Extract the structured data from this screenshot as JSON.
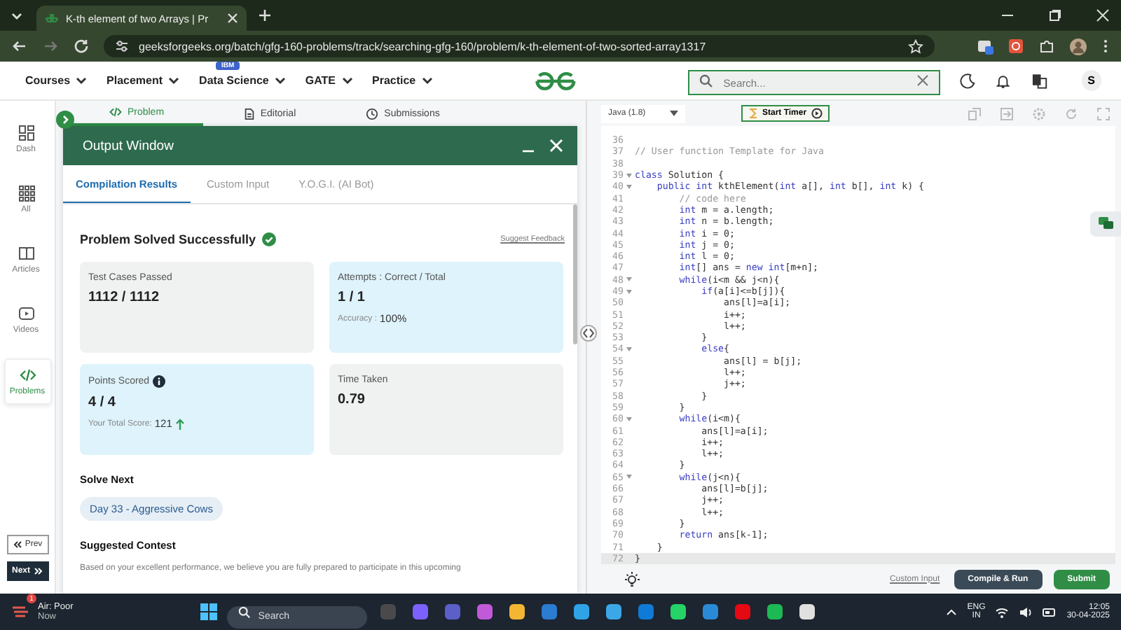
{
  "browser": {
    "tab_title": "K-th element of two Arrays | Pr",
    "url": "geeksforgeeks.org/batch/gfg-160-problems/track/searching-gfg-160/problem/k-th-element-of-two-sorted-array1317"
  },
  "site_nav": {
    "items": [
      {
        "label": "Courses"
      },
      {
        "label": "Placement"
      },
      {
        "label": "Data Science",
        "badge": "IBM"
      },
      {
        "label": "GATE"
      },
      {
        "label": "Practice"
      }
    ],
    "search": {
      "placeholder": "Search..."
    },
    "avatar": "S"
  },
  "sidebar": {
    "items": [
      {
        "label": "Dash",
        "kind": "dash",
        "selected": false
      },
      {
        "label": "All",
        "kind": "all",
        "selected": false
      },
      {
        "label": "Articles",
        "kind": "articles",
        "selected": false
      },
      {
        "label": "Videos",
        "kind": "videos",
        "selected": false
      },
      {
        "label": "Problems",
        "kind": "problems",
        "selected": true
      }
    ],
    "prev": "Prev",
    "next": "Next"
  },
  "problem_tabs": [
    {
      "label": "Problem",
      "kind": "code",
      "selected": true
    },
    {
      "label": "Editorial",
      "kind": "doc",
      "selected": false
    },
    {
      "label": "Submissions",
      "kind": "clock",
      "selected": false
    }
  ],
  "output_window": {
    "title": "Output Window",
    "tabs": [
      {
        "label": "Compilation Results",
        "selected": true
      },
      {
        "label": "Custom Input",
        "selected": false
      },
      {
        "label": "Y.O.G.I. (AI Bot)",
        "selected": false
      }
    ],
    "status": "Problem Solved Successfully",
    "feedback_link": "Suggest Feedback",
    "cards": [
      {
        "label": "Test Cases Passed",
        "value": "1112 / 1112",
        "tinted": false,
        "info": false,
        "rising": false
      },
      {
        "label": "Attempts : Correct / Total",
        "value": "1 / 1",
        "tinted": true,
        "info": false,
        "rising": false,
        "note": {
          "label": "Accuracy : ",
          "value": "100%"
        }
      },
      {
        "label": "Points Scored",
        "value": "4 / 4",
        "tinted": true,
        "info": true,
        "rising": true,
        "note": {
          "label": "Your Total Score: ",
          "value": "121"
        }
      },
      {
        "label": "Time Taken",
        "value": "0.79",
        "tinted": false,
        "info": false,
        "rising": false
      }
    ],
    "solve_next": {
      "heading": "Solve Next",
      "chip": "Day 33 - Aggressive Cows"
    },
    "suggested_contest": {
      "heading": "Suggested Contest",
      "text": "Based on your excellent performance, we believe you are fully prepared to participate in this upcoming"
    }
  },
  "editor": {
    "language": "Java (1.8)",
    "timer_button": "Start Timer",
    "lines": [
      {
        "number": "36",
        "fold": false,
        "current": false
      },
      {
        "number": "37",
        "fold": false,
        "current": false,
        "parts": [
          {
            "kind": "comment",
            "text": "// User function Template for Java"
          }
        ]
      },
      {
        "number": "38",
        "fold": false,
        "current": false
      },
      {
        "number": "39",
        "fold": true,
        "current": false,
        "parts": [
          {
            "kind": "keyword",
            "text": "class"
          },
          {
            "kind": "plain",
            "text": " Solution {"
          }
        ]
      },
      {
        "number": "40",
        "fold": true,
        "current": false,
        "parts": [
          {
            "kind": "keyword",
            "text": "    public int"
          },
          {
            "kind": "plain",
            "text": " kthElement("
          },
          {
            "kind": "keyword",
            "text": "int"
          },
          {
            "kind": "plain",
            "text": " a[], "
          },
          {
            "kind": "keyword",
            "text": "int"
          },
          {
            "kind": "plain",
            "text": " b[], "
          },
          {
            "kind": "keyword",
            "text": "int"
          },
          {
            "kind": "plain",
            "text": " k) {"
          }
        ]
      },
      {
        "number": "41",
        "fold": false,
        "current": false,
        "parts": [
          {
            "kind": "comment",
            "text": "        // code here"
          }
        ]
      },
      {
        "number": "42",
        "fold": false,
        "current": false,
        "parts": [
          {
            "kind": "keyword",
            "text": "        int"
          },
          {
            "kind": "plain",
            "text": " m = a.length;"
          }
        ]
      },
      {
        "number": "43",
        "fold": false,
        "current": false,
        "parts": [
          {
            "kind": "keyword",
            "text": "        int"
          },
          {
            "kind": "plain",
            "text": " n = b.length;"
          }
        ]
      },
      {
        "number": "44",
        "fold": false,
        "current": false,
        "parts": [
          {
            "kind": "keyword",
            "text": "        int"
          },
          {
            "kind": "plain",
            "text": " i = 0;"
          }
        ]
      },
      {
        "number": "45",
        "fold": false,
        "current": false,
        "parts": [
          {
            "kind": "keyword",
            "text": "        int"
          },
          {
            "kind": "plain",
            "text": " j = 0;"
          }
        ]
      },
      {
        "number": "46",
        "fold": false,
        "current": false,
        "parts": [
          {
            "kind": "keyword",
            "text": "        int"
          },
          {
            "kind": "plain",
            "text": " l = 0;"
          }
        ]
      },
      {
        "number": "47",
        "fold": false,
        "current": false,
        "parts": [
          {
            "kind": "keyword",
            "text": "        int"
          },
          {
            "kind": "plain",
            "text": "[] ans = "
          },
          {
            "kind": "keyword",
            "text": "new int"
          },
          {
            "kind": "plain",
            "text": "[m+n];"
          }
        ]
      },
      {
        "number": "48",
        "fold": true,
        "current": false,
        "parts": [
          {
            "kind": "keyword",
            "text": "        while"
          },
          {
            "kind": "plain",
            "text": "(i<m && j<n){"
          }
        ]
      },
      {
        "number": "49",
        "fold": true,
        "current": false,
        "parts": [
          {
            "kind": "keyword",
            "text": "            if"
          },
          {
            "kind": "plain",
            "text": "(a[i]<=b[j]){"
          }
        ]
      },
      {
        "number": "50",
        "fold": false,
        "current": false,
        "parts": [
          {
            "kind": "plain",
            "text": "                ans[l]=a[i];"
          }
        ]
      },
      {
        "number": "51",
        "fold": false,
        "current": false,
        "parts": [
          {
            "kind": "plain",
            "text": "                i++;"
          }
        ]
      },
      {
        "number": "52",
        "fold": false,
        "current": false,
        "parts": [
          {
            "kind": "plain",
            "text": "                l++;"
          }
        ]
      },
      {
        "number": "53",
        "fold": false,
        "current": false,
        "parts": [
          {
            "kind": "plain",
            "text": "            }"
          }
        ]
      },
      {
        "number": "54",
        "fold": true,
        "current": false,
        "parts": [
          {
            "kind": "keyword",
            "text": "            else"
          },
          {
            "kind": "plain",
            "text": "{"
          }
        ]
      },
      {
        "number": "55",
        "fold": false,
        "current": false,
        "parts": [
          {
            "kind": "plain",
            "text": "                ans[l] = b[j];"
          }
        ]
      },
      {
        "number": "56",
        "fold": false,
        "current": false,
        "parts": [
          {
            "kind": "plain",
            "text": "                l++;"
          }
        ]
      },
      {
        "number": "57",
        "fold": false,
        "current": false,
        "parts": [
          {
            "kind": "plain",
            "text": "                j++;"
          }
        ]
      },
      {
        "number": "58",
        "fold": false,
        "current": false,
        "parts": [
          {
            "kind": "plain",
            "text": "            }"
          }
        ]
      },
      {
        "number": "59",
        "fold": false,
        "current": false,
        "parts": [
          {
            "kind": "plain",
            "text": "        }"
          }
        ]
      },
      {
        "number": "60",
        "fold": true,
        "current": false,
        "parts": [
          {
            "kind": "keyword",
            "text": "        while"
          },
          {
            "kind": "plain",
            "text": "(i<m){"
          }
        ]
      },
      {
        "number": "61",
        "fold": false,
        "current": false,
        "parts": [
          {
            "kind": "plain",
            "text": "            ans[l]=a[i];"
          }
        ]
      },
      {
        "number": "62",
        "fold": false,
        "current": false,
        "parts": [
          {
            "kind": "plain",
            "text": "            i++;"
          }
        ]
      },
      {
        "number": "63",
        "fold": false,
        "current": false,
        "parts": [
          {
            "kind": "plain",
            "text": "            l++;"
          }
        ]
      },
      {
        "number": "64",
        "fold": false,
        "current": false,
        "parts": [
          {
            "kind": "plain",
            "text": "        }"
          }
        ]
      },
      {
        "number": "65",
        "fold": true,
        "current": false,
        "parts": [
          {
            "kind": "keyword",
            "text": "        while"
          },
          {
            "kind": "plain",
            "text": "(j<n){"
          }
        ]
      },
      {
        "number": "66",
        "fold": false,
        "current": false,
        "parts": [
          {
            "kind": "plain",
            "text": "            ans[l]=b[j];"
          }
        ]
      },
      {
        "number": "67",
        "fold": false,
        "current": false,
        "parts": [
          {
            "kind": "plain",
            "text": "            j++;"
          }
        ]
      },
      {
        "number": "68",
        "fold": false,
        "current": false,
        "parts": [
          {
            "kind": "plain",
            "text": "            l++;"
          }
        ]
      },
      {
        "number": "69",
        "fold": false,
        "current": false,
        "parts": [
          {
            "kind": "plain",
            "text": "        }"
          }
        ]
      },
      {
        "number": "70",
        "fold": false,
        "current": false,
        "parts": [
          {
            "kind": "keyword",
            "text": "        return"
          },
          {
            "kind": "plain",
            "text": " ans[k-1];"
          }
        ]
      },
      {
        "number": "71",
        "fold": false,
        "current": false,
        "parts": [
          {
            "kind": "plain",
            "text": "    }"
          }
        ]
      },
      {
        "number": "72",
        "fold": false,
        "current": true,
        "parts": [
          {
            "kind": "plain",
            "text": "}"
          }
        ]
      }
    ],
    "custom_input_link": "Custom Input",
    "compile_button": "Compile & Run",
    "submit_button": "Submit"
  },
  "taskbar": {
    "weather": {
      "badge": "1",
      "title": "Air: Poor",
      "subtitle": "Now"
    },
    "search": {
      "placeholder": "Search"
    },
    "language": "ENG",
    "region": "IN",
    "time": "12:05",
    "date": "30-04-2025"
  }
}
